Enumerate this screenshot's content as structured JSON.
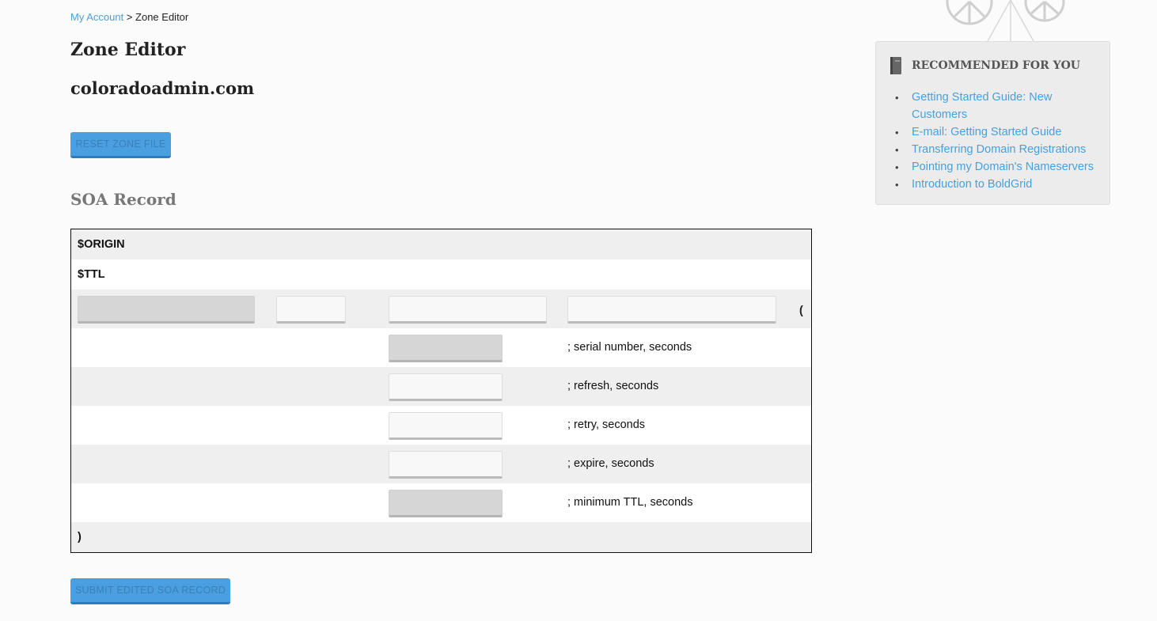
{
  "breadcrumb": {
    "link": "My Account",
    "separator": " > ",
    "current": "Zone Editor"
  },
  "page_title": "Zone Editor",
  "domain": "coloradoadmin.com",
  "buttons": {
    "reset": "RESET ZONE FILE",
    "submit": "SUBMIT EDITED SOA RECORD"
  },
  "soa": {
    "title": "SOA Record",
    "origin_label": "$ORIGIN",
    "ttl_label": "$TTL",
    "open_paren": "(",
    "close_paren": ")",
    "fields": [
      {
        "comment": "; serial number, seconds",
        "disabled": true
      },
      {
        "comment": "; refresh, seconds",
        "disabled": false
      },
      {
        "comment": "; retry, seconds",
        "disabled": false
      },
      {
        "comment": "; expire, seconds",
        "disabled": false
      },
      {
        "comment": "; minimum TTL, seconds",
        "disabled": true
      }
    ]
  },
  "sidebar": {
    "heading": "RECOMMENDED FOR YOU",
    "links": [
      "Getting Started Guide: New Customers",
      "E-mail: Getting Started Guide",
      "Transferring Domain Registrations",
      "Pointing my Domain's Nameservers",
      "Introduction to BoldGrid"
    ]
  },
  "icons": {
    "sidebar": "book-icon",
    "header": "wheel-decoration-icon"
  },
  "colors": {
    "link": "#4a9fd8",
    "button": "#4a9fe0",
    "row_shade": "#efefef"
  }
}
